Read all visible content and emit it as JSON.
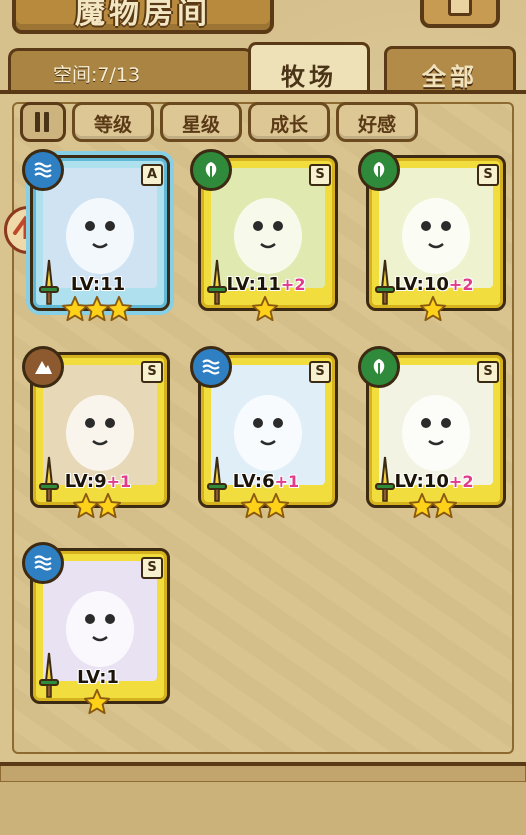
{
  "header": {
    "title": "魔物房间",
    "corner_button_icon": "inventory-icon"
  },
  "tabs": {
    "space_label": "空间:7/13",
    "pasture_label": "牧场",
    "all_label": "全部"
  },
  "filters": {
    "sort_icon": "sort-toggle-icon",
    "buttons": [
      "等级",
      "星级",
      "成长",
      "好感"
    ]
  },
  "colors": {
    "water": "#2f7fc3",
    "grass": "#2f8a3b",
    "earth": "#8c5a2e",
    "card_gold": "#f2dd3e",
    "selected_blue": "#aee0ee",
    "bonus_pink": "#e23b8a"
  },
  "monsters": [
    {
      "name_icon": "blue-bell-girl",
      "attribute": "water",
      "rank": "A",
      "level": "LV:11",
      "bonus": "",
      "stars": 3,
      "selected": true
    },
    {
      "name_icon": "green-slime-sprout",
      "attribute": "grass",
      "rank": "S",
      "level": "LV:11",
      "bonus": "+2",
      "stars": 1,
      "selected": false
    },
    {
      "name_icon": "leaf-fairy",
      "attribute": "grass",
      "rank": "S",
      "level": "LV:10",
      "bonus": "+2",
      "stars": 1,
      "selected": false
    },
    {
      "name_icon": "scarecrow-witch",
      "attribute": "earth",
      "rank": "S",
      "level": "LV:9",
      "bonus": "+1",
      "stars": 2,
      "selected": false
    },
    {
      "name_icon": "ice-lily-fairy",
      "attribute": "water",
      "rank": "S",
      "level": "LV:6",
      "bonus": "+1",
      "stars": 2,
      "selected": false
    },
    {
      "name_icon": "radish-spirit",
      "attribute": "grass",
      "rank": "S",
      "level": "LV:10",
      "bonus": "+2",
      "stars": 2,
      "selected": false
    },
    {
      "name_icon": "feather-owl-girl",
      "attribute": "water",
      "rank": "S",
      "level": "LV:1",
      "bonus": "",
      "stars": 1,
      "selected": false
    }
  ]
}
